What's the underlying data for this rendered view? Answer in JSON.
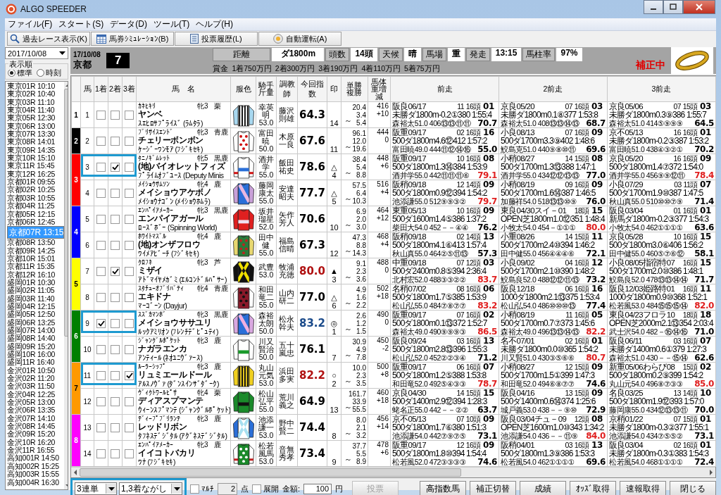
{
  "window": {
    "title": "ALGO SPEEDER"
  },
  "menu": [
    "ファイル(F)",
    "スタート(S)",
    "データ(D)",
    "ツール(T)",
    "ヘルプ(H)"
  ],
  "toolbar": [
    {
      "label": "過去レース表示(K)",
      "kind": "search"
    },
    {
      "label": "馬券ｼﾐｭﾚｰｼｮﾝ(B)",
      "kind": "table"
    },
    {
      "label": "投票履歴(L)",
      "kind": "doc"
    },
    {
      "label": "自動運転(A)",
      "kind": "disc"
    }
  ],
  "date_picker": {
    "value": "2017/10/08"
  },
  "sort_order": {
    "label": "表示順",
    "options": [
      {
        "label": "標準",
        "selected": true
      },
      {
        "label": "時刻",
        "selected": false
      }
    ]
  },
  "races": [
    {
      "label": "東京01R 10:10",
      "selected": false
    },
    {
      "label": "東京02R 10:40",
      "selected": false
    },
    {
      "label": "東京03R 11:10",
      "selected": false
    },
    {
      "label": "東京04R 11:40",
      "selected": false
    },
    {
      "label": "東京05R 12:30",
      "selected": false
    },
    {
      "label": "東京06R 13:00",
      "selected": false
    },
    {
      "label": "東京07R 13:30",
      "selected": false
    },
    {
      "label": "東京08R 14:01",
      "selected": false
    },
    {
      "label": "東京09R 14:35",
      "selected": false
    },
    {
      "label": "東京10R 15:10",
      "selected": false
    },
    {
      "label": "東京11R 15:45",
      "selected": false
    },
    {
      "label": "東京12R 16:25",
      "selected": false
    },
    {
      "label": "京都01R 09:55",
      "selected": false
    },
    {
      "label": "京都02R 10:25",
      "selected": false
    },
    {
      "label": "京都03R 10:55",
      "selected": false
    },
    {
      "label": "京都04R 11:25",
      "selected": false
    },
    {
      "label": "京都05R 12:15",
      "selected": false
    },
    {
      "label": "京都06R 12:45",
      "selected": false
    },
    {
      "label": "京都07R 13:15",
      "selected": true
    },
    {
      "label": "京都08R 13:50",
      "selected": false
    },
    {
      "label": "京都09R 14:25",
      "selected": false
    },
    {
      "label": "京都10R 15:01",
      "selected": false
    },
    {
      "label": "京都11R 15:35",
      "selected": false
    },
    {
      "label": "京都12R 16:10",
      "selected": false
    },
    {
      "label": "盛岡01R 10:30",
      "selected": false
    },
    {
      "label": "盛岡02R 11:05",
      "selected": false
    },
    {
      "label": "盛岡03R 11:40",
      "selected": false
    },
    {
      "label": "盛岡04R 12:15",
      "selected": false
    },
    {
      "label": "盛岡05R 12:50",
      "selected": false
    },
    {
      "label": "盛岡06R 13:25",
      "selected": false
    },
    {
      "label": "盛岡07R 14:00",
      "selected": false
    },
    {
      "label": "盛岡08R 14:40",
      "selected": false
    },
    {
      "label": "盛岡09R 15:20",
      "selected": false
    },
    {
      "label": "盛岡10R 16:00",
      "selected": false
    },
    {
      "label": "盛岡11R 16:40",
      "selected": false
    },
    {
      "label": "金沢01R 10:50",
      "selected": false
    },
    {
      "label": "金沢02R 11:20",
      "selected": false
    },
    {
      "label": "金沢03R 11:50",
      "selected": false
    },
    {
      "label": "金沢04R 12:25",
      "selected": false
    },
    {
      "label": "金沢05R 13:00",
      "selected": false
    },
    {
      "label": "金沢06R 13:35",
      "selected": false
    },
    {
      "label": "金沢07R 14:10",
      "selected": false
    },
    {
      "label": "金沢08R 14:45",
      "selected": false
    },
    {
      "label": "金沢09R 15:20",
      "selected": false
    },
    {
      "label": "金沢10R 16:20",
      "selected": false
    },
    {
      "label": "金沢11R 16:55",
      "selected": false
    },
    {
      "label": "高知001R 14:50",
      "selected": false
    },
    {
      "label": "高知002R 15:25",
      "selected": false
    },
    {
      "label": "高知003R 15:55",
      "selected": false
    },
    {
      "label": "高知004R 16:30",
      "selected": false
    }
  ],
  "race_header": {
    "date": "17/10/08",
    "venue": "京都",
    "race_number": "7",
    "info": [
      {
        "label": "距離",
        "value": "ダ1800m"
      },
      {
        "label": "頭数",
        "value": "14頭"
      },
      {
        "label": "天候",
        "value": "晴"
      },
      {
        "label": "馬場",
        "value": "重"
      },
      {
        "label": "発走",
        "value": "13:15"
      },
      {
        "label": "馬柱率",
        "value": "97%"
      }
    ],
    "prize": [
      "賞金",
      "1着750万円",
      "2着300万円",
      "3着190万円",
      "4着110万円",
      "5着75万円"
    ],
    "status": "補正中"
  },
  "table": {
    "columns": [
      "馬",
      "1着",
      "2着",
      "3着",
      "馬　名",
      "服色",
      "騎手斤量",
      "調教師",
      "今回指数",
      "印",
      "単勝複勝",
      "馬体重増減",
      "前走",
      "2前走",
      "3前走"
    ],
    "gates": [
      {
        "number": "1",
        "color": "#ffffff",
        "horses": [
          {
            "no": "1",
            "picks": [
              false,
              false,
              false
            ],
            "highlighted": false,
            "sire": "ｶﾈﾋｷﾘ",
            "sex_age": "牝3",
            "coat": "栗",
            "name": "ヤンベ",
            "dam": "ｽｴﾋﾛｻﾌﾟﾗｲｽﾞ (ﾗﾑﾀﾗ)",
            "jockey": "幸英明",
            "weight": "53.0",
            "trainer": "藤沢則雄",
            "index": {
              "value": "64.3",
              "color": "#000000"
            },
            "popularity": "14",
            "win": "20.4",
            "place_low": "3.4",
            "odds_sep": "～",
            "place_high": "5.4",
            "body_weight": "416",
            "weight_change": "+10",
            "past": [
              {
                "race": "阪良06/17",
                "order": "11 16頭",
                "finish": "01",
                "course": "未勝ダ1800m-0.2①380 1:55:4",
                "run": "森裕太51.0 406⑬⑬⑪⑪",
                "index": "70.7",
                "highlight": false
              },
              {
                "race": "京良05/20",
                "order": "07 16頭",
                "finish": "03",
                "course": "未勝ダ1800m0.1⑧377 1:53:8",
                "run": "森裕太51.0 408⑬⑬⑭⑬",
                "index": "68.7",
                "highlight": false
              },
              {
                "race": "京良05/06",
                "order": "07 15頭",
                "finish": "03",
                "course": "未勝ダ1800m0.3⑨386 1:55:7",
                "run": "森裕太51.0 414⑤⑨⑨⑨",
                "index": "64.5",
                "highlight": false
              }
            ]
          }
        ]
      },
      {
        "number": "2",
        "color": "#000000",
        "horses": [
          {
            "no": "2",
            "picks": [
              false,
              false,
              false
            ],
            "highlighted": false,
            "sire": "ﾌﾞﾘｻｲｽｴﾝﾄﾞ",
            "sex_age": "牝3",
            "coat": "青鹿",
            "name": "チェリーボンボン",
            "dam": "ｹｰｼﾞｰﾜﾝﾓｱ (ﾌｼﾞｷｾｷ)",
            "jockey": "富田暁",
            "weight": "50.0",
            "trainer": "木原一良",
            "index": {
              "value": "67.6",
              "color": "#000000"
            },
            "popularity": "11",
            "win": "96.1",
            "place_low": "12.0",
            "odds_sep": "～",
            "place_high": "19.6",
            "body_weight": "444",
            "weight_change": "0",
            "past": [
              {
                "race": "阪重09/17",
                "order": "02 16頭",
                "finish": "16",
                "course": "500ダ1800m4.6⑫412 1:57:2",
                "run": "富田暁49.0 444⑪⑫⑭⑯",
                "index": "55.0",
                "highlight": false
              },
              {
                "race": "小良08/13",
                "order": "07 16頭",
                "finish": "09",
                "course": "500ダ1700m3.3⑨402 1:48:6",
                "run": "鮫島克51.0 440⑨⑧⑩⑪",
                "index": "69.6",
                "highlight": false
              },
              {
                "race": "京不05/13",
                "order": "16 16頭",
                "finish": "01",
                "course": "未勝ダ1800m-0.2③387 1:53:2",
                "run": "富田暁51.0 438④③②①",
                "index": "70.2",
                "highlight": false
              }
            ]
          }
        ]
      },
      {
        "number": "3",
        "color": "#ff0000",
        "horses": [
          {
            "no": "3",
            "picks": [
              false,
              true,
              false
            ],
            "highlighted": true,
            "sire": "ﾀﾆﾉｷﾞﾑﾚｯﾄ",
            "sex_age": "牝5",
            "coat": "黒鹿",
            "name": "(地)バイオレットフィズ",
            "dam": "ﾌﾟﾗｲﾑｵﾌﾞﾕｰｽ (Deputy Minis",
            "jockey": "酒井学",
            "weight": "55.0",
            "trainer": "飯田祐史",
            "index": {
              "value": "78.6",
              "color": "#000000"
            },
            "mark": "△",
            "popularity": "4",
            "win": "38.4",
            "place_low": "5.4",
            "odds_sep": "～",
            "place_high": "8.8",
            "body_weight": "448",
            "weight_change": "+6",
            "past": [
              {
                "race": "阪重09/17",
                "order": "10 16頭",
                "finish": "08",
                "course": "500ダ1800m1.3⑭384 1:53:9",
                "run": "酒井学55.0 442⑪⑪⑪⑥",
                "index": "79.1",
                "highlight": true
              },
              {
                "race": "小稍08/27",
                "order": "14 15頭",
                "finish": "08",
                "course": "500ダ1700m1.3⑬388 1:47:1",
                "run": "酒井学55.0 434⑫⑫⑬⑬",
                "index": "77.0",
                "highlight": false
              },
              {
                "race": "京良05/20",
                "order": "16 16頭",
                "finish": "09",
                "course": "500ダ1800m1.4⑦372 1:54:0",
                "run": "酒井学55.0 456⑨⑨⑫⑪",
                "index": "78.4",
                "highlight": true
              }
            ]
          },
          {
            "no": "4",
            "picks": [
              false,
              false,
              false
            ],
            "highlighted": false,
            "sire": "ﾒｲｼｮｳｻﾑｿﾝ",
            "sex_age": "牝4",
            "coat": "鹿",
            "name": "メイショウアケボノ",
            "dam": "ﾒｲｼｮｳﾅｺﾞﾝ (ﾒｲｼｮｳﾎﾑﾗ)",
            "jockey": "藤岡康太",
            "weight": "55.0",
            "trainer": "安達昭夫",
            "index": {
              "value": "77.7",
              "color": "#000000"
            },
            "mark": "△",
            "popularity": "5",
            "win": "57.5",
            "place_low": "6.4",
            "odds_sep": "～",
            "place_high": "10.3",
            "body_weight": "516",
            "weight_change": "+4",
            "past": [
              {
                "race": "阪稍09/18",
                "order": "12 14頭",
                "finish": "09",
                "course": "500ダ1800m0.9⑫394 1:54:2",
                "run": "池添謙55.0 512⑨⑨③②",
                "index": "79.7",
                "highlight": true
              },
              {
                "race": "小稍08/19",
                "order": "09 16頭",
                "finish": "09",
                "course": "500ダ1700m1.6⑭387 1:46:5",
                "run": "加藤祥54.0 518⑬⑬⑩⑨",
                "index": "76.0",
                "highlight": false
              },
              {
                "race": "小良07/29",
                "order": "03 11頭",
                "finish": "07",
                "course": "500ダ1700m1.9⑩387 1:47:5",
                "run": "秋山真55.0 510⑩⑩⑦⑨",
                "index": "71.4",
                "highlight": false
              }
            ]
          }
        ]
      },
      {
        "number": "4",
        "color": "#0000ff",
        "horses": [
          {
            "no": "5",
            "picks": [
              false,
              false,
              false
            ],
            "highlighted": false,
            "sire": "ｴﾝﾊﾟｲｱﾒｰｶｰ",
            "sex_age": "牝3",
            "coat": "黒鹿",
            "name": "エンパイアガール",
            "dam": "ﾛｰｽﾞﾎﾞｰ (Spinning World)",
            "jockey": "坂井瑠星",
            "weight": "52.0",
            "trainer": "矢作芳人",
            "index": {
              "value": "70.6",
              "color": "#000000"
            },
            "popularity": "10",
            "win": "6.9",
            "place_low": "2.0",
            "odds_sep": "～",
            "place_high": "3.0",
            "body_weight": "464",
            "weight_change": "+12",
            "past": [
              {
                "race": "東重05/13",
                "order": "10 16頭",
                "finish": "09",
                "course": "500ダ1600m1.4⑤386 1:37:2",
                "run": "柴田大54.0 452－－④④",
                "index": "76.2",
                "highlight": false
              },
              {
                "race": "東良04/30スイ－01",
                "order": "18頭",
                "finish": "15",
                "course": "OPEN芝1800m1.0⑫351 1:48:4",
                "run": "小牧太54.0 454－①①①",
                "index": "80.0",
                "highlight": true
              },
              {
                "race": "阪良03/04",
                "order": "01 16頭",
                "finish": "01",
                "course": "新馬ダ1800m-0.2③377 1:54:3",
                "run": "小牧太54.0 462①①①①",
                "index": "63.6",
                "highlight": false
              }
            ]
          },
          {
            "no": "6",
            "picks": [
              false,
              false,
              false
            ],
            "highlighted": false,
            "sire": "ﾎﾜｲﾄﾏｽﾞﾙ",
            "sex_age": "牝4",
            "coat": "鹿",
            "name": "(地)オンザフロウ",
            "dam": "ﾜｲﾒｱﾋﾞｰﾁ (ﾌｼﾞｷｾｷ)",
            "jockey": "田中健",
            "weight": "55.0",
            "trainer": "福島信晴",
            "index": {
              "value": "67.3",
              "color": "#000000"
            },
            "popularity": "12",
            "win": "47.3",
            "place_low": "8.8",
            "odds_sep": "～",
            "place_high": "14.3",
            "body_weight": "468",
            "weight_change": "+4",
            "past": [
              {
                "race": "阪稍09/18",
                "order": "02 14頭",
                "finish": "13",
                "course": "500ダ1800m4.1⑥413 1:57:4",
                "run": "秋山真55.0 464②⑤⑪⑬",
                "index": "57.3",
                "highlight": false
              },
              {
                "race": "小重08/26",
                "order": "14 15頭",
                "finish": "11",
                "course": "500ダ1700m2.4⑩394 1:46:2",
                "run": "田中健55.0 456④④④⑥",
                "index": "72.1",
                "highlight": false
              },
              {
                "race": "京良05/28",
                "order": "10 16頭",
                "finish": "15",
                "course": "500ダ1800m3.0⑥406 1:56:2",
                "run": "田中健55.0 460⑤⑦⑥⑫",
                "index": "58.1",
                "highlight": false
              }
            ]
          }
        ]
      },
      {
        "number": "5",
        "color": "#ffff00",
        "horses": [
          {
            "no": "7",
            "picks": [
              false,
              true,
              false
            ],
            "highlighted": false,
            "sire": "ｸﾛﾌﾈ",
            "sex_age": "牝3",
            "coat": "芦",
            "name": "ミザイ",
            "dam": "ｱﾄﾞﾏｲﾔﾒｶﾞﾐ (ｴﾙｺﾝﾄﾞﾙﾊﾟｻｰ)",
            "jockey": "武豊",
            "weight": "53.0",
            "trainer": "牧浦充徳",
            "index": {
              "value": "80.0",
              "color": "#b01010"
            },
            "mark": "▲",
            "popularity": "3",
            "win": "9.1",
            "place_low": "2.3",
            "odds_sep": "～",
            "place_high": "3.6",
            "body_weight": "488",
            "weight_change": "0",
            "past": [
              {
                "race": "中重09/18",
                "order": "07 12頭",
                "finish": "03",
                "course": "500ダ2400m0.8⑤394 2:36:4",
                "run": "北村宏52.0 488③③②②",
                "index": "83.7",
                "highlight": true
              },
              {
                "race": "小良09/02",
                "order": "04 16頭",
                "finish": "12",
                "course": "500ダ1700m2.1⑩390 1:48:2",
                "run": "鮫島良52.0 488⑫⑫⑪⑬",
                "index": "73.2",
                "highlight": false
              },
              {
                "race": "小良08/05指宿特07",
                "order": "16頭",
                "finish": "15",
                "course": "500ダ1700m2.0⑩386 1:48:1",
                "run": "鮫島良52.0 478⑬⑬⑭⑭",
                "index": "71.7",
                "highlight": false
              }
            ]
          },
          {
            "no": "8",
            "picks": [
              false,
              false,
              false
            ],
            "highlighted": false,
            "sire": "ｽﾀﾁｭｰｵﾌﾞﾘﾊﾞﾃｨ",
            "sex_age": "牝4",
            "coat": "青鹿",
            "name": "エキドナ",
            "dam": "ﾏｰｺﾞｰﾝ (Dayjur)",
            "jockey": "和田竜二",
            "weight": "55.0",
            "trainer": "山内研二",
            "index": {
              "value": "77.0",
              "color": "#000000"
            },
            "mark": "△",
            "popularity": "6",
            "win": "4.9",
            "place_low": "1.6",
            "odds_sep": "～",
            "place_high": "2.2",
            "body_weight": "502",
            "weight_change": "+18",
            "past": [
              {
                "race": "名稍07/02",
                "order": "08 16頭",
                "finish": "06",
                "course": "500ダ1800m1.7⑤385 1:53:9",
                "run": "松山弘55.0 484⑦⑧⑦⑦",
                "index": "83.2",
                "highlight": true
              },
              {
                "race": "阪良12/18",
                "order": "06 16頭",
                "finish": "16",
                "course": "1000ダ1800m2.1⑬375 1:53:4",
                "run": "松山弘54.0 486⑩⑩⑩⑬",
                "index": "77.4",
                "highlight": false
              },
              {
                "race": "阪良12/03姫路特01",
                "order": "16頭",
                "finish": "11",
                "course": "1000ダ1800m0.9⑩368 1:52:1",
                "run": "松若風53.0 484⑮⑮⑮⑭",
                "index": "82.0",
                "highlight": true
              }
            ]
          }
        ]
      },
      {
        "number": "6",
        "color": "#008000",
        "horses": [
          {
            "no": "9",
            "picks": [
              true,
              false,
              false
            ],
            "highlighted": true,
            "sire": "ｽｽﾞｶﾏﾝﾎﾞ",
            "sex_age": "牝3",
            "coat": "黒鹿",
            "name": "メイショウササユリ",
            "dam": "ﾙｯｸｱﾐﾘｵﾝ (ﾌﾚﾝﾁﾃﾞﾋﾟｭﾃｨ)",
            "jockey": "森裕太朗",
            "weight": "50.0",
            "trainer": "松永幹夫",
            "index": {
              "value": "83.2",
              "color": "#1a4a8a"
            },
            "mark": "◎",
            "popularity": "1",
            "win": "2.6",
            "place_low": "1.2",
            "odds_sep": "～",
            "place_high": "1.5",
            "body_weight": "490",
            "weight_change": "0",
            "past": [
              {
                "race": "阪重09/17",
                "order": "07 16頭",
                "finish": "02",
                "course": "500ダ1800m0.1⑬372 1:52:7",
                "run": "森裕太49.0 490⑨⑨⑨③",
                "index": "86.5",
                "highlight": true
              },
              {
                "race": "小稍08/19",
                "order": "11 16頭",
                "finish": "05",
                "course": "500ダ1700m0.7⑦373 1:45:6",
                "run": "森裕太49.0 496⑬⑬⑭⑬",
                "index": "82.2",
                "highlight": true
              },
              {
                "race": "東良04/23フロラ10",
                "order": "18頭",
                "finish": "18",
                "course": "OPEN芝2000m2.1⑬354 2:03:4",
                "run": "武士沢54.0 482－⑯⑭⑯",
                "index": "71.0",
                "highlight": false
              }
            ]
          },
          {
            "no": "10",
            "picks": [
              false,
              false,
              false
            ],
            "highlighted": false,
            "sire": "ｼﾞｬﾝｸﾞﾙﾎﾟｹｯﾄ",
            "sex_age": "牝3",
            "coat": "鹿",
            "name": "ナガラエンカ",
            "dam": "ｱﾝﾃｨｰﾙ (ﾈｵﾕﾆｳﾞｧｰｽ)",
            "jockey": "川又賢治",
            "weight": "50.0",
            "trainer": "五十嵐忠",
            "index": {
              "value": "76.1",
              "color": "#000000"
            },
            "popularity": "7",
            "win": "30.9",
            "place_low": "4.9",
            "odds_sep": "～",
            "place_high": "7.8",
            "body_weight": "450",
            "weight_change": "-2",
            "past": [
              {
                "race": "阪良09/24",
                "order": "03 16頭",
                "finish": "13",
                "course": "500ダ1800m2.8⑬396 1:55:3",
                "run": "松山弘52.0 452②②③④",
                "index": "71.2",
                "highlight": false
              },
              {
                "race": "名不07/01",
                "order": "02 16頭",
                "finish": "01",
                "course": "未勝ダ1800m0.0⑩365 1:54:2",
                "run": "川又賢51.0 430③⑤⑥⑥",
                "index": "80.7",
                "highlight": true
              },
              {
                "race": "阪良06/11",
                "order": "03 16頭",
                "finish": "07",
                "course": "未勝ダ1400m0.6①379 1:27:3",
                "run": "森裕太51.0 430－－⑮⑭",
                "index": "62.6",
                "highlight": false
              }
            ]
          }
        ]
      },
      {
        "number": "7",
        "color": "#ff9900",
        "horses": [
          {
            "no": "11",
            "picks": [
              false,
              false,
              true
            ],
            "highlighted": true,
            "sire": "ﾙｰﾗｰｼｯﾌﾟ",
            "sex_age": "牝3",
            "coat": "鹿",
            "name": "リュミエールドール",
            "dam": "ｱﾙｽﾉｳﾞｧ (ﾀﾞﾝｽｲﾝｻﾞﾀﾞｰｸ)",
            "jockey": "丸山元気",
            "weight": "53.0",
            "trainer": "浜田多実",
            "index": {
              "value": "82.2",
              "color": "#b01010"
            },
            "mark": "○",
            "popularity": "2",
            "win": "10.0",
            "place_low": "2.3",
            "odds_sep": "～",
            "place_high": "3.5",
            "body_weight": "500",
            "weight_change": "+8",
            "past": [
              {
                "race": "阪重09/17",
                "order": "06 16頭",
                "finish": "07",
                "course": "500ダ1800m1.2⑤388 1:53:8",
                "run": "和田竜52.0 492⑤④③③",
                "index": "78.7",
                "highlight": true
              },
              {
                "race": "小稍08/27",
                "order": "12 15頭",
                "finish": "09",
                "course": "500ダ1700m1.5①399 1:47:3",
                "run": "和田竜52.0 494⑥⑧⑦⑦",
                "index": "74.6",
                "highlight": false
              },
              {
                "race": "新重05/06わらび08",
                "order": "15頭",
                "finish": "02",
                "course": "500ダ1800m0.2⑨399 1:54:2",
                "run": "丸山元54.0 496⑧⑦③③",
                "index": "85.0",
                "highlight": true
              }
            ]
          },
          {
            "no": "12",
            "picks": [
              false,
              false,
              false
            ],
            "highlighted": false,
            "sire": "ｳﾞｨｸﾄﾜｰﾙﾋﾟｻ",
            "sex_age": "牝4",
            "coat": "栗",
            "name": "ディアスプマンテ",
            "dam": "ｳｨｰﾝｽﾌﾟﾏﾝﾃ (ｼﾞｬﾝｸﾞﾙﾎﾟｹｯﾄ)",
            "jockey": "松山弘平",
            "weight": "55.0",
            "trainer": "荒川義之",
            "index": {
              "value": "64.9",
              "color": "#000000"
            },
            "popularity": "13",
            "win": "161.7",
            "place_low": "33.9",
            "odds_sep": "～",
            "place_high": "55.5",
            "body_weight": "460",
            "weight_change": "+18",
            "past": [
              {
                "race": "京良04/30",
                "order": "14 15頭",
                "finish": "15",
                "course": "500ダ1400m2.9⑫394 1:28:3",
                "run": "蛯名正55.0 442－－②②",
                "index": "63.7",
                "highlight": false
              },
              {
                "race": "阪良04/16",
                "order": "13 15頭",
                "finish": "09",
                "course": "500ダ1400m0.6⑭374 1:25:6",
                "run": "城戸義53.0 438－－⑨⑩",
                "index": "72.9",
                "highlight": false
              },
              {
                "race": "名良03/25",
                "order": "13 14頭",
                "finish": "10",
                "course": "500ダ1800m1.9⑫393 1:57:0",
                "run": "藤岡康55.0 434⑫⑬⑬⑪",
                "index": "70.0",
                "highlight": false
              }
            ]
          }
        ]
      },
      {
        "number": "8",
        "color": "#ff00ff",
        "horses": [
          {
            "no": "13",
            "picks": [
              false,
              false,
              false
            ],
            "highlighted": false,
            "sire": "ﾃﾞｨｰﾌﾟﾌﾞﾘﾗﾝﾃ",
            "sex_age": "牝3",
            "coat": "鹿",
            "name": "レッドリボン",
            "dam": "ﾀﾌﾈｽﾃﾞｼﾞﾀﾙ (ｱｸﾞﾈｽﾃﾞｼﾞﾀﾙ)",
            "jockey": "池添謙一",
            "weight": "53.0",
            "trainer": "野中賢二",
            "index": {
              "value": "74.4",
              "color": "#000000"
            },
            "popularity": "8",
            "win": "8.0",
            "place_low": "2.1",
            "odds_sep": "～",
            "place_high": "3.2",
            "body_weight": "456",
            "weight_change": "+14",
            "past": [
              {
                "race": "京不05/13",
                "order": "07 10頭",
                "finish": "09",
                "course": "500ダ1800m1.7⑥380 1:51:3",
                "run": "池添謙54.0 442⑦⑨⑦⑤",
                "index": "73.1",
                "highlight": false
              },
              {
                "race": "阪良03/04チュ－09",
                "order": "12頭",
                "finish": "08",
                "course": "OPEN芝1600m1.0⑩343 1:34:2",
                "run": "池添謙54.0 436－－⑪⑨",
                "index": "84.0",
                "highlight": true
              },
              {
                "race": "京稍01/22",
                "order": "07 15頭",
                "finish": "01",
                "course": "未勝ダ1800m-0.3②377 1:55:1",
                "run": "池添謙54.0 434⑦⑤⑤②",
                "index": "73.1",
                "highlight": false
              }
            ]
          },
          {
            "no": "14",
            "picks": [
              false,
              false,
              false
            ],
            "highlighted": false,
            "sire": "ｴﾝﾊﾟｲｱﾒｰｶｰ",
            "sex_age": "牝3",
            "coat": "鹿",
            "name": "イイコトバカリ",
            "dam": "ﾜﾅ (ﾌｼﾞｷｾｷ)",
            "jockey": "松若風馬",
            "weight": "53.0",
            "trainer": "音無秀孝",
            "index": {
              "value": "73.4",
              "color": "#000000"
            },
            "popularity": "9",
            "win": "37.7",
            "place_low": "5.5",
            "odds_sep": "～",
            "place_high": "8.9",
            "body_weight": "478",
            "weight_change": "+6",
            "past": [
              {
                "race": "阪重09/17",
                "order": "12 16頭",
                "finish": "09",
                "course": "500ダ1800m1.8⑩394 1:54:4",
                "run": "松若風52.0 472③③③③",
                "index": "74.6",
                "highlight": false
              },
              {
                "race": "阪稍04/01",
                "order": "03 16頭",
                "finish": "13",
                "course": "500ダ1800m1.3⑨386 1:53:3",
                "run": "松若風54.0 462①①①①",
                "index": "69.6",
                "highlight": false
              },
              {
                "race": "阪良03/04",
                "order": "02 16頭",
                "finish": "01",
                "course": "未勝ダ1800m-0.3①383 1:54:3",
                "run": "松若風54.0 468①①①①",
                "index": "72.4",
                "highlight": false
              }
            ]
          }
        ]
      }
    ]
  },
  "bet_bar": {
    "highlighted": true,
    "bet_type": "3連単",
    "method": "1,3着ながし",
    "multi": {
      "label": "ﾏﾙﾁ",
      "checked": false
    },
    "count": "2",
    "count_unit": "点",
    "expand": {
      "label": "展開",
      "checked": false
    },
    "amount_label": "金額:",
    "amount": "100",
    "amount_unit": "円",
    "vote": {
      "label": "投票",
      "disabled": true
    }
  },
  "buttons": [
    "高指数馬",
    "補正切替",
    "成績",
    "ｵｯｽﾞ取得",
    "速報取得",
    "閉じる"
  ]
}
